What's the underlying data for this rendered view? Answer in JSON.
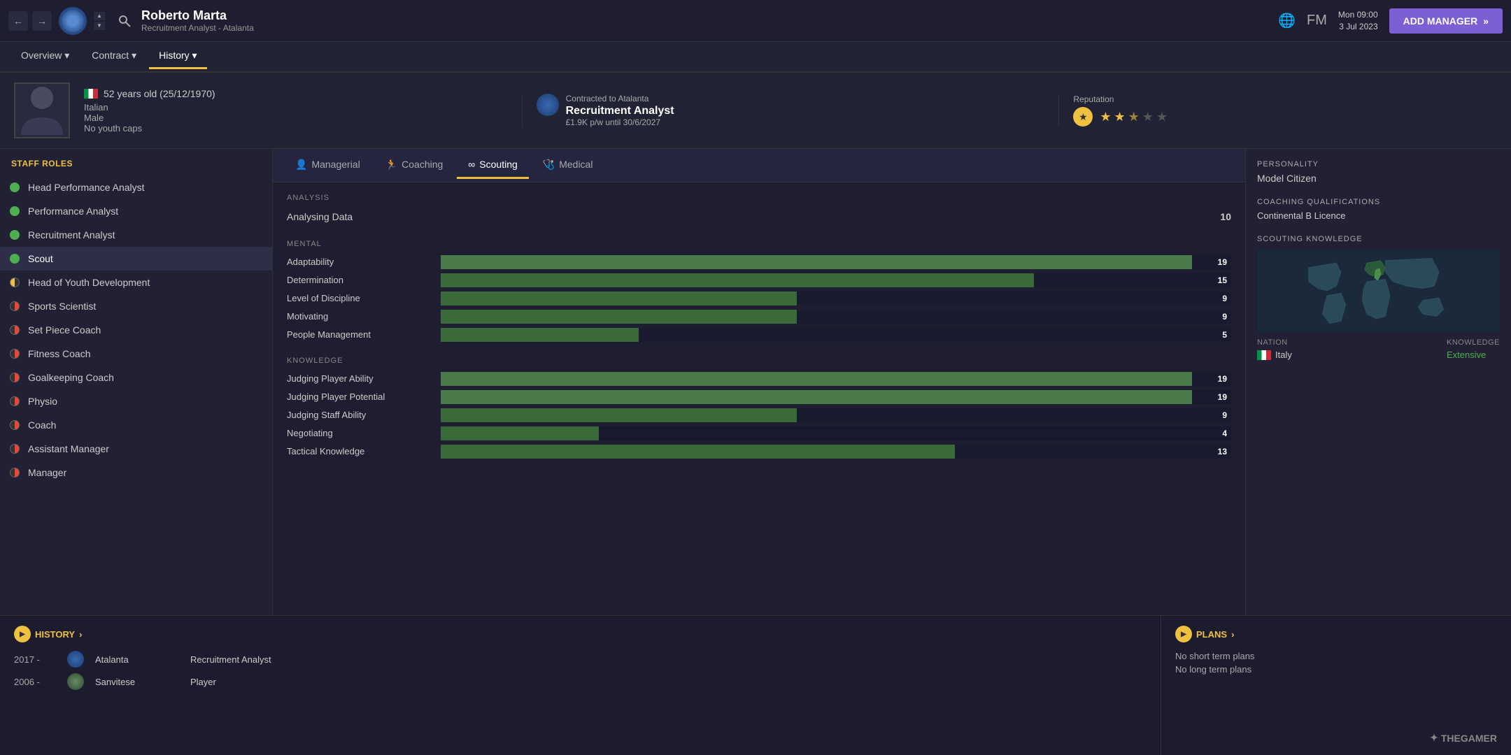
{
  "topBar": {
    "personName": "Roberto Marta",
    "personSubtitle": "Recruitment Analyst - Atalanta",
    "datetime": "Mon 09:00",
    "date": "3 Jul 2023",
    "addManagerLabel": "ADD MANAGER"
  },
  "navTabs": [
    {
      "label": "Overview",
      "dropdown": true,
      "active": false
    },
    {
      "label": "Contract",
      "dropdown": true,
      "active": false
    },
    {
      "label": "History",
      "dropdown": true,
      "active": false
    }
  ],
  "profile": {
    "age": "52 years old (25/12/1970)",
    "nationality": "Italian",
    "gender": "Male",
    "youthCaps": "No youth caps",
    "contractLabel": "Contracted to Atalanta",
    "contractRole": "Recruitment Analyst",
    "contractDetails": "£1.9K p/w until 30/6/2027",
    "reputationLabel": "Reputation"
  },
  "staffRolesTitle": "STAFF ROLES",
  "staffRoles": [
    {
      "name": "Head Performance Analyst",
      "dotType": "green",
      "active": false
    },
    {
      "name": "Performance Analyst",
      "dotType": "green",
      "active": false
    },
    {
      "name": "Recruitment Analyst",
      "dotType": "green",
      "active": false
    },
    {
      "name": "Scout",
      "dotType": "green",
      "active": true
    },
    {
      "name": "Head of Youth Development",
      "dotType": "half",
      "active": false
    },
    {
      "name": "Sports Scientist",
      "dotType": "red-left",
      "active": false
    },
    {
      "name": "Set Piece Coach",
      "dotType": "red-left",
      "active": false
    },
    {
      "name": "Fitness Coach",
      "dotType": "red-left",
      "active": false
    },
    {
      "name": "Goalkeeping Coach",
      "dotType": "red-left",
      "active": false
    },
    {
      "name": "Physio",
      "dotType": "red-left",
      "active": false
    },
    {
      "name": "Coach",
      "dotType": "red-left",
      "active": false
    },
    {
      "name": "Assistant Manager",
      "dotType": "red-left",
      "active": false
    },
    {
      "name": "Manager",
      "dotType": "red-left",
      "active": false
    }
  ],
  "abilityTabs": [
    {
      "label": "Managerial",
      "icon": "person",
      "active": false
    },
    {
      "label": "Coaching",
      "icon": "coaching",
      "active": false
    },
    {
      "label": "Scouting",
      "icon": "scouting",
      "active": true
    },
    {
      "label": "Medical",
      "icon": "medical",
      "active": false
    }
  ],
  "analysis": {
    "title": "ANALYSIS",
    "items": [
      {
        "label": "Analysing Data",
        "value": 10
      }
    ]
  },
  "mental": {
    "title": "MENTAL",
    "attributes": [
      {
        "name": "Adaptability",
        "value": 19,
        "max": 20,
        "highlight": true
      },
      {
        "name": "Determination",
        "value": 15,
        "max": 20,
        "highlight": false
      },
      {
        "name": "Level of Discipline",
        "value": 9,
        "max": 20,
        "highlight": false
      },
      {
        "name": "Motivating",
        "value": 9,
        "max": 20,
        "highlight": false
      },
      {
        "name": "People Management",
        "value": 5,
        "max": 20,
        "highlight": false
      }
    ]
  },
  "knowledge": {
    "title": "KNOWLEDGE",
    "attributes": [
      {
        "name": "Judging Player Ability",
        "value": 19,
        "max": 20,
        "highlight": true
      },
      {
        "name": "Judging Player Potential",
        "value": 19,
        "max": 20,
        "highlight": true
      },
      {
        "name": "Judging Staff Ability",
        "value": 9,
        "max": 20,
        "highlight": false
      },
      {
        "name": "Negotiating",
        "value": 4,
        "max": 20,
        "highlight": false
      },
      {
        "name": "Tactical Knowledge",
        "value": 13,
        "max": 20,
        "highlight": false
      }
    ]
  },
  "rightPanel": {
    "personalityTitle": "PERSONALITY",
    "personalityValue": "Model Citizen",
    "coachingQualTitle": "COACHING QUALIFICATIONS",
    "coachingQual": "Continental B Licence",
    "scoutingKnowledgeTitle": "SCOUTING KNOWLEDGE",
    "nationTitle": "NATION",
    "knowledgeTitle": "KNOWLEDGE",
    "nation": "Italy",
    "knowledgeLevel": "Extensive"
  },
  "history": {
    "title": "HISTORY",
    "rows": [
      {
        "year": "2017 -",
        "club": "Atalanta",
        "role": "Recruitment Analyst"
      },
      {
        "year": "2006 -",
        "club": "Sanvitese",
        "role": "Player"
      }
    ]
  },
  "plans": {
    "title": "PLANS",
    "shortTerm": "No short term plans",
    "longTerm": "No long term plans"
  }
}
